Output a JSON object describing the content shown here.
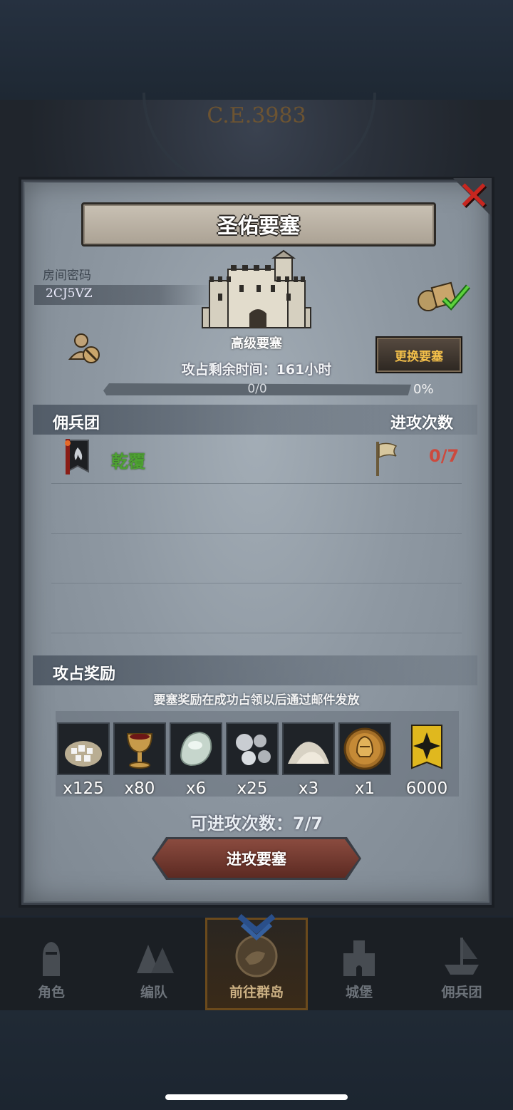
{
  "background": {
    "era_text": "C.E.3983"
  },
  "dialog": {
    "title": "圣佑要塞",
    "room_label": "房间密码",
    "room_code": "2CJ5VZ",
    "fortress_level": "高级要塞",
    "change_button": "更换要塞",
    "timer": "攻占剩余时间：161小时",
    "progress": {
      "text": "0/0",
      "percent_text": "0%",
      "fraction": 0
    },
    "legion_header": "佣兵团",
    "attack_header": "进攻次数",
    "legions": [
      {
        "name": "乾覆",
        "attacks": "0/7"
      }
    ],
    "reward_header": "攻占奖励",
    "reward_note": "要塞奖励在成功占领以后通过邮件发放",
    "rewards": [
      {
        "icon": "salt-sack-icon",
        "qty": "x125"
      },
      {
        "icon": "goblet-icon",
        "qty": "x80"
      },
      {
        "icon": "moonstone-icon",
        "qty": "x6"
      },
      {
        "icon": "silver-ore-icon",
        "qty": "x25"
      },
      {
        "icon": "powder-pile-icon",
        "qty": "x3"
      },
      {
        "icon": "knight-helmet-coin-icon",
        "qty": "x1"
      },
      {
        "icon": "guild-banner-icon",
        "qty": "6000"
      }
    ],
    "remaining_attacks": "可进攻次数：7/7",
    "attack_button": "进攻要塞"
  },
  "nav": {
    "items": [
      {
        "label": "角色",
        "icon": "knight-icon"
      },
      {
        "label": "编队",
        "icon": "formation-icon"
      },
      {
        "label": "前往群岛",
        "icon": "islands-map-icon",
        "active": true
      },
      {
        "label": "城堡",
        "icon": "castle-icon"
      },
      {
        "label": "佣兵团",
        "icon": "mercenary-ship-icon"
      }
    ]
  },
  "colors": {
    "legion_name": "#4ea232",
    "attack_count": "#cc4a3e",
    "change_button_text": "#f4c04a",
    "close_x": "#c7261f"
  }
}
